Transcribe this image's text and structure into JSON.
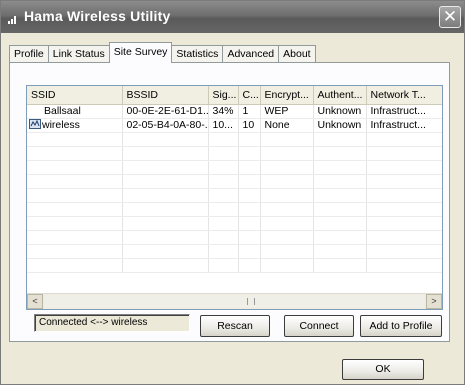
{
  "window": {
    "title": "Hama Wireless Utility",
    "close_glyph": "✕"
  },
  "tabs": [
    {
      "label": "Profile",
      "active": false
    },
    {
      "label": "Link Status",
      "active": false
    },
    {
      "label": "Site Survey",
      "active": true
    },
    {
      "label": "Statistics",
      "active": false
    },
    {
      "label": "Advanced",
      "active": false
    },
    {
      "label": "About",
      "active": false
    }
  ],
  "table": {
    "columns": [
      "SSID",
      "BSSID",
      "Sig...",
      "C...",
      "Encrypt...",
      "Authent...",
      "Network T..."
    ],
    "rows": [
      {
        "ssid": "Ballsaal",
        "bssid": "00-0E-2E-61-D1...",
        "signal": "34%",
        "channel": "1",
        "encryption": "WEP",
        "auth": "Unknown",
        "network_type": "Infrastruct...",
        "connected": false
      },
      {
        "ssid": "wireless",
        "bssid": "02-05-B4-0A-80-...",
        "signal": "10...",
        "channel": "10",
        "encryption": "None",
        "auth": "Unknown",
        "network_type": "Infrastruct...",
        "connected": true
      }
    ]
  },
  "scrollbar": {
    "left_glyph": "<",
    "right_glyph": ">"
  },
  "status": {
    "text": "Connected <--> wireless"
  },
  "buttons": {
    "rescan": "Rescan",
    "connect": "Connect",
    "add_to_profile": "Add to Profile",
    "ok": "OK"
  },
  "icons": {
    "title": "signal-bars-icon",
    "connected": "wifi-connected-icon"
  }
}
